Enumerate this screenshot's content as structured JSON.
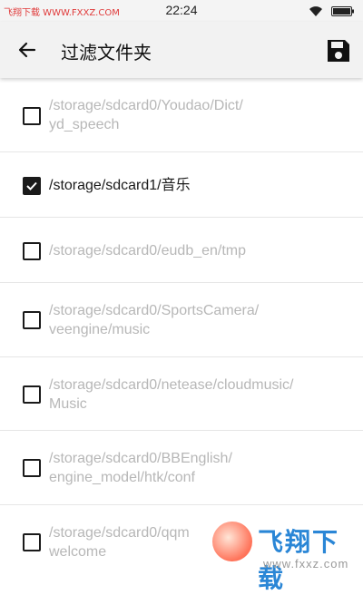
{
  "status_bar": {
    "watermark": "飞翔下载 WWW.FXXZ.COM",
    "time": "22:24",
    "wifi_icon": "wifi-icon",
    "battery_icon": "battery-icon"
  },
  "app_bar": {
    "title": "过滤文件夹",
    "back_icon": "arrow-left-icon",
    "save_icon": "floppy-disk-icon"
  },
  "folders": [
    {
      "path": "/storage/sdcard0/Youdao/Dict/\nyd_speech",
      "checked": false
    },
    {
      "path": "/storage/sdcard1/音乐",
      "checked": true
    },
    {
      "path": "/storage/sdcard0/eudb_en/tmp",
      "checked": false
    },
    {
      "path": "/storage/sdcard0/SportsCamera/\nveengine/music",
      "checked": false
    },
    {
      "path": "/storage/sdcard0/netease/cloudmusic/\nMusic",
      "checked": false
    },
    {
      "path": "/storage/sdcard0/BBEnglish/\nengine_model/htk/conf",
      "checked": false
    },
    {
      "path": "/storage/sdcard0/qqm\nwelcome",
      "checked": false
    }
  ],
  "watermark_overlay": {
    "brand": "飞翔下载",
    "url": "www.fxxz.com"
  },
  "colors": {
    "active_text": "#1a1a1a",
    "inactive_text": "#b7b7b7",
    "app_bar_bg": "#f2f2f2"
  }
}
